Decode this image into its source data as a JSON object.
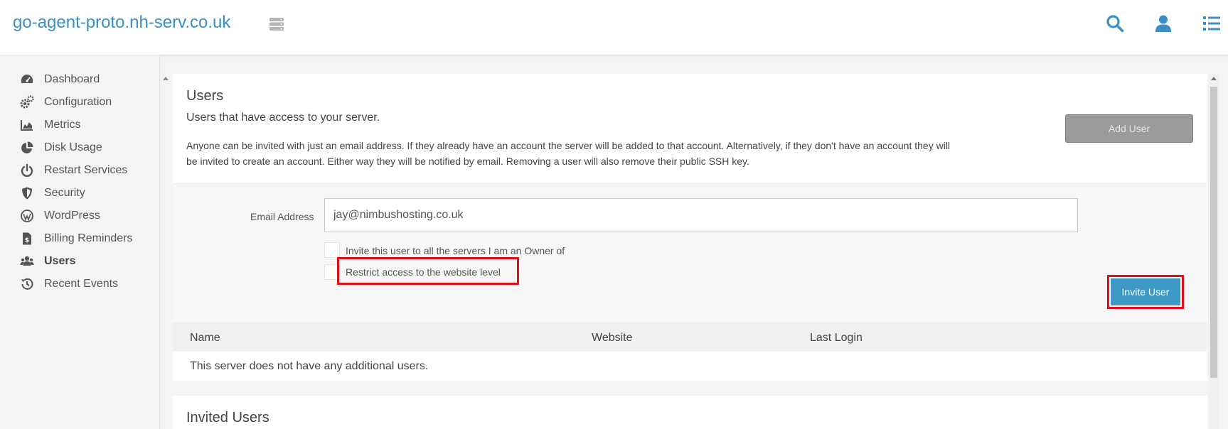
{
  "header": {
    "server_name": "go-agent-proto.nh-serv.co.uk",
    "icons": [
      "server-icon",
      "search-icon",
      "user-icon",
      "list-icon"
    ]
  },
  "sidebar": {
    "items": [
      {
        "label": "Dashboard",
        "icon": "dashboard-icon",
        "active": false
      },
      {
        "label": "Configuration",
        "icon": "cogs-icon",
        "active": false
      },
      {
        "label": "Metrics",
        "icon": "chart-area-icon",
        "active": false
      },
      {
        "label": "Disk Usage",
        "icon": "pie-chart-icon",
        "active": false
      },
      {
        "label": "Restart Services",
        "icon": "power-icon",
        "active": false
      },
      {
        "label": "Security",
        "icon": "shield-icon",
        "active": false
      },
      {
        "label": "WordPress",
        "icon": "wordpress-icon",
        "active": false
      },
      {
        "label": "Billing Reminders",
        "icon": "invoice-icon",
        "active": false
      },
      {
        "label": "Users",
        "icon": "users-icon",
        "active": true
      },
      {
        "label": "Recent Events",
        "icon": "history-icon",
        "active": false
      }
    ]
  },
  "users_card": {
    "title": "Users",
    "subtitle": "Users that have access to your server.",
    "description": "Anyone can be invited with just an email address. If they already have an account the server will be added to that account. Alternatively, if they don't have an account they will be invited to create an account. Either way they will be notified by email. Removing a user will also remove their public SSH key.",
    "add_user_label": "Add User"
  },
  "invite_form": {
    "email_label": "Email Address",
    "email_value": "jay@nimbushosting.co.uk",
    "option_all_servers": "Invite this user to all the servers I am an Owner of",
    "option_restrict": "Restrict access to the website level",
    "invite_button": "Invite User",
    "highlight_color": "#e00f1a",
    "accent_color": "#3d99c4"
  },
  "users_table": {
    "columns": [
      "Name",
      "Website",
      "Last Login"
    ],
    "empty_message": "This server does not have any additional users."
  },
  "invited_card": {
    "title": "Invited Users"
  }
}
